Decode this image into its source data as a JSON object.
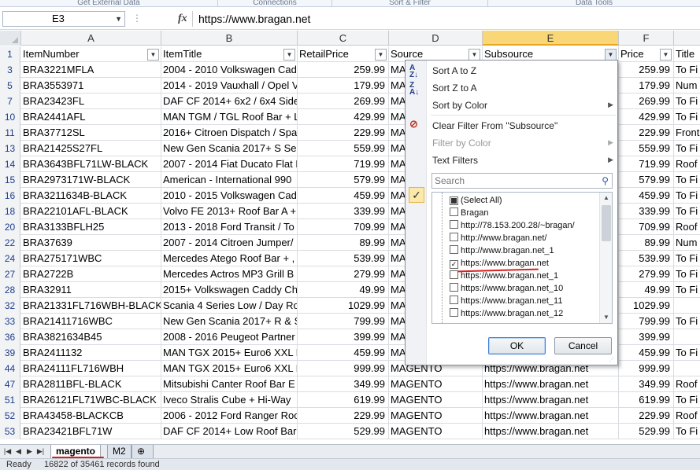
{
  "ribbon": {
    "groups": [
      "Get External Data",
      "Connections",
      "Sort & Filter",
      "Data Tools"
    ]
  },
  "formula_bar": {
    "name_box": "E3",
    "fx_label": "fx",
    "formula": "https://www.bragan.net"
  },
  "columns": {
    "letters": [
      "A",
      "B",
      "C",
      "D",
      "E",
      "F",
      ""
    ],
    "selected": "E"
  },
  "header_row": {
    "row_number": "1",
    "cells": [
      "ItemNumber",
      "ItemTitle",
      "RetailPrice",
      "Source",
      "Subsource",
      "Price",
      "Title"
    ]
  },
  "rows": [
    {
      "rn": "3",
      "item": "BRA3221MFLA",
      "title": "2004 - 2010 Volkswagen Cad",
      "retail": "259.99",
      "source": "MA",
      "sub": "",
      "price": "259.99",
      "t": "To Fi"
    },
    {
      "rn": "5",
      "item": "BRA3553971",
      "title": "2014 - 2019 Vauxhall / Opel V",
      "retail": "179.99",
      "source": "MA",
      "sub": "",
      "price": "179.99",
      "t": "Num"
    },
    {
      "rn": "7",
      "item": "BRA23423FL",
      "title": "DAF CF 2014+ 6x2 / 6x4 Side",
      "retail": "269.99",
      "source": "MA",
      "sub": "",
      "price": "269.99",
      "t": "To Fi"
    },
    {
      "rn": "10",
      "item": "BRA2441AFL",
      "title": "MAN TGM / TGL Roof Bar + L",
      "retail": "429.99",
      "source": "MA",
      "sub": "",
      "price": "429.99",
      "t": "To Fi"
    },
    {
      "rn": "11",
      "item": "BRA37712SL",
      "title": "2016+ Citroen Dispatch / Spa",
      "retail": "229.99",
      "source": "MA",
      "sub": "",
      "price": "229.99",
      "t": "Front"
    },
    {
      "rn": "13",
      "item": "BRA21425S27FL",
      "title": "New Gen Scania 2017+ S Ser",
      "retail": "559.99",
      "source": "MA",
      "sub": "",
      "price": "559.99",
      "t": "To Fi"
    },
    {
      "rn": "14",
      "item": "BRA3643BFL71LW-BLACK",
      "title": "2007 - 2014 Fiat Ducato Flat L",
      "retail": "719.99",
      "source": "MA",
      "sub": "",
      "price": "719.99",
      "t": "Roof"
    },
    {
      "rn": "15",
      "item": "BRA2973171W-BLACK",
      "title": "American - International 990",
      "retail": "579.99",
      "source": "MA",
      "sub": "",
      "price": "579.99",
      "t": "To Fi"
    },
    {
      "rn": "16",
      "item": "BRA3211634B-BLACK",
      "title": "2010 - 2015 Volkswagen Cad",
      "retail": "459.99",
      "source": "MA",
      "sub": "",
      "price": "459.99",
      "t": "To Fi"
    },
    {
      "rn": "18",
      "item": "BRA22101AFL-BLACK",
      "title": "Volvo FE 2013+ Roof Bar A +",
      "retail": "339.99",
      "source": "MA",
      "sub": "",
      "price": "339.99",
      "t": "To Fi"
    },
    {
      "rn": "20",
      "item": "BRA3133BFLH25",
      "title": "2013 - 2018 Ford Transit / To",
      "retail": "709.99",
      "source": "MA",
      "sub": "",
      "price": "709.99",
      "t": "Roof"
    },
    {
      "rn": "22",
      "item": "BRA37639",
      "title": "2007 - 2014 Citroen Jumper/",
      "retail": "89.99",
      "source": "MA",
      "sub": "",
      "price": "89.99",
      "t": "Num"
    },
    {
      "rn": "24",
      "item": "BRA275171WBC",
      "title": "Mercedes Atego Roof Bar + ,",
      "retail": "539.99",
      "source": "MA",
      "sub": "",
      "price": "539.99",
      "t": "To Fi"
    },
    {
      "rn": "27",
      "item": "BRA2722B",
      "title": "Mercedes Actros MP3 Grill B",
      "retail": "279.99",
      "source": "MA",
      "sub": "",
      "price": "279.99",
      "t": "To Fi"
    },
    {
      "rn": "28",
      "item": "BRA32911",
      "title": "2015+ Volkswagen Caddy Ch",
      "retail": "49.99",
      "source": "MA",
      "sub": "",
      "price": "49.99",
      "t": "To Fi"
    },
    {
      "rn": "32",
      "item": "BRA21331FL716WBH-BLACK",
      "title": "Scania 4 Series Low / Day Ro",
      "retail": "1029.99",
      "source": "MA",
      "sub": "",
      "price": "1029.99",
      "t": ""
    },
    {
      "rn": "33",
      "item": "BRA21411716WBC",
      "title": "New Gen Scania 2017+ R & S",
      "retail": "799.99",
      "source": "MA",
      "sub": "",
      "price": "799.99",
      "t": "To Fi"
    },
    {
      "rn": "36",
      "item": "BRA3821634B45",
      "title": "2008 - 2016 Peugeot Partner",
      "retail": "399.99",
      "source": "MA",
      "sub": "",
      "price": "399.99",
      "t": ""
    },
    {
      "rn": "39",
      "item": "BRA2411132",
      "title": "MAN TGX 2015+ Euro6 XXL R",
      "retail": "459.99",
      "source": "MA",
      "sub": "",
      "price": "459.99",
      "t": "To Fi"
    },
    {
      "rn": "44",
      "item": "BRA24111FL716WBH",
      "title": "MAN TGX 2015+ Euro6 XXL R",
      "retail": "999.99",
      "source": "MAGENTO",
      "sub": "https://www.bragan.net",
      "price": "999.99",
      "t": ""
    },
    {
      "rn": "47",
      "item": "BRA2811BFL-BLACK",
      "title": "Mitsubishi Canter Roof Bar E",
      "retail": "349.99",
      "source": "MAGENTO",
      "sub": "https://www.bragan.net",
      "price": "349.99",
      "t": "Roof"
    },
    {
      "rn": "51",
      "item": "BRA26121FL71WBC-BLACK",
      "title": "Iveco Stralis Cube + Hi-Way",
      "retail": "619.99",
      "source": "MAGENTO",
      "sub": "https://www.bragan.net",
      "price": "619.99",
      "t": "To Fi"
    },
    {
      "rn": "52",
      "item": "BRA43458-BLACKCB",
      "title": "2006 - 2012 Ford Ranger Roo",
      "retail": "229.99",
      "source": "MAGENTO",
      "sub": "https://www.bragan.net",
      "price": "229.99",
      "t": "Roof"
    },
    {
      "rn": "53",
      "item": "BRA23421BFL71W",
      "title": "DAF CF 2014+ Low Roof Bar E",
      "retail": "529.99",
      "source": "MAGENTO",
      "sub": "https://www.bragan.net",
      "price": "529.99",
      "t": "To Fi"
    }
  ],
  "filter_menu": {
    "sort_az": "Sort A to Z",
    "sort_za": "Sort Z to A",
    "sort_color": "Sort by Color",
    "clear_filter": "Clear Filter From \"Subsource\"",
    "filter_color": "Filter by Color",
    "text_filters": "Text Filters",
    "search_placeholder": "Search",
    "values": [
      {
        "label": "(Select All)",
        "state": "partial"
      },
      {
        "label": "Bragan",
        "state": "unchecked"
      },
      {
        "label": "http://78.153.200.28/~bragan/",
        "state": "unchecked"
      },
      {
        "label": "http://www.bragan.net/",
        "state": "unchecked"
      },
      {
        "label": "http://www.bragan.net_1",
        "state": "unchecked"
      },
      {
        "label": "https://www.bragan.net",
        "state": "checked"
      },
      {
        "label": "https://www.bragan.net_1",
        "state": "unchecked"
      },
      {
        "label": "https://www.bragan.net_10",
        "state": "unchecked"
      },
      {
        "label": "https://www.bragan.net_11",
        "state": "unchecked"
      },
      {
        "label": "https://www.bragan.net_12",
        "state": "unchecked"
      }
    ],
    "ok_label": "OK",
    "cancel_label": "Cancel"
  },
  "sheets": {
    "tabs": [
      "magento",
      "M2"
    ],
    "active": "magento"
  },
  "status": {
    "mode": "Ready",
    "records": "16822 of 35461 records found"
  },
  "colors": {
    "selected_column": "#f9d777",
    "annotation": "#d92020",
    "link_blue": "#1f3c8a"
  }
}
